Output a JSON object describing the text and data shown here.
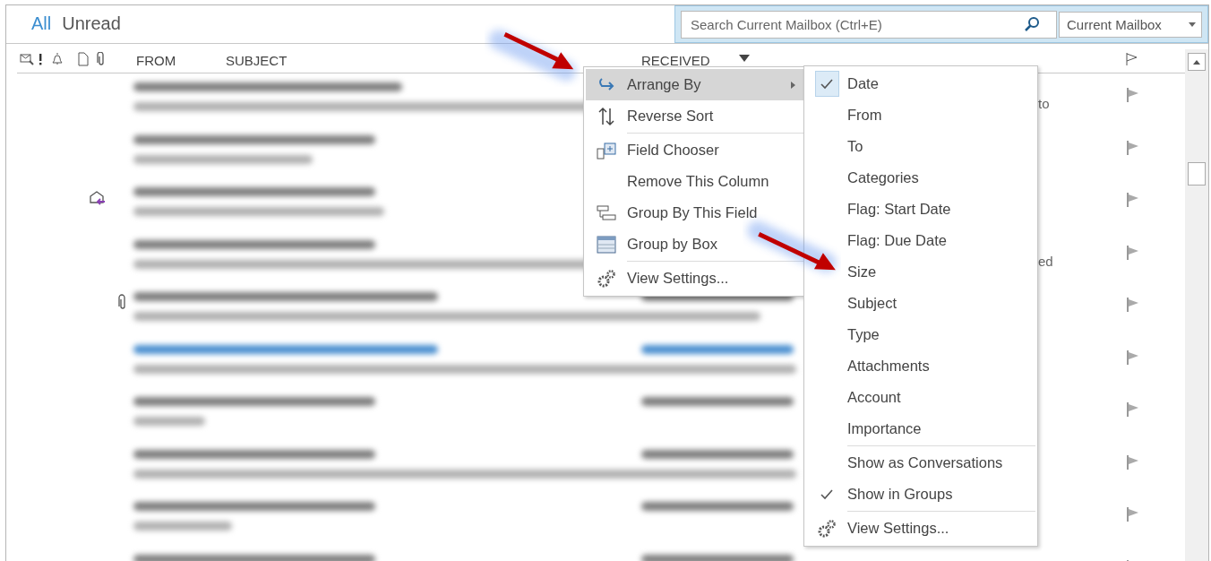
{
  "tabs": [
    {
      "label": "All",
      "selected": true
    },
    {
      "label": "Unread",
      "selected": false
    }
  ],
  "search": {
    "placeholder": "Search Current Mailbox (Ctrl+E)",
    "scope": "Current Mailbox"
  },
  "columns": [
    {
      "kind": "icon"
    },
    {
      "kind": "icon"
    },
    {
      "kind": "icon"
    },
    {
      "kind": "icon"
    },
    {
      "kind": "icon"
    },
    {
      "kind": "text",
      "label": "FROM"
    },
    {
      "kind": "text",
      "label": "SUBJECT"
    },
    {
      "kind": "text",
      "label": "RECEIVED",
      "sorted": true
    },
    {
      "kind": "icon"
    }
  ],
  "messages": [
    {
      "unread": false,
      "replied": false,
      "attachment": false,
      "fragment": "to"
    },
    {
      "unread": false,
      "replied": false,
      "attachment": false
    },
    {
      "unread": false,
      "replied": true,
      "attachment": false
    },
    {
      "unread": false,
      "replied": false,
      "attachment": false,
      "fragment": "ed"
    },
    {
      "unread": false,
      "replied": false,
      "attachment": true
    },
    {
      "unread": true,
      "replied": false,
      "attachment": false
    },
    {
      "unread": false,
      "replied": false,
      "attachment": false
    },
    {
      "unread": false,
      "replied": false,
      "attachment": false
    },
    {
      "unread": false,
      "replied": false,
      "attachment": false
    },
    {
      "unread": false,
      "replied": false,
      "attachment": false
    }
  ],
  "context_menu": {
    "sections": [
      {
        "items": [
          {
            "label": "Arrange By",
            "selected": true,
            "submenu": true
          },
          {
            "label": "Reverse Sort",
            "selected": false,
            "submenu": false
          }
        ]
      },
      {
        "items": [
          {
            "label": "Field Chooser",
            "selected": false,
            "submenu": false
          },
          {
            "label": "Remove This Column",
            "selected": false,
            "submenu": false
          },
          {
            "label": "Group By This Field",
            "selected": false,
            "submenu": false
          },
          {
            "label": "Group by Box",
            "selected": false,
            "submenu": false
          }
        ]
      },
      {
        "items": [
          {
            "label": "View Settings...",
            "selected": false,
            "submenu": false
          }
        ]
      }
    ]
  },
  "arrange_submenu": {
    "sections": [
      {
        "items": [
          {
            "kind": "option",
            "label": "Date",
            "checked": true
          },
          {
            "kind": "option",
            "label": "From",
            "checked": false
          },
          {
            "kind": "option",
            "label": "To",
            "checked": false
          },
          {
            "kind": "option",
            "label": "Categories",
            "checked": false
          },
          {
            "kind": "option",
            "label": "Flag: Start Date",
            "checked": false
          },
          {
            "kind": "option",
            "label": "Flag: Due Date",
            "checked": false
          },
          {
            "kind": "option",
            "label": "Size",
            "checked": false
          },
          {
            "kind": "option",
            "label": "Subject",
            "checked": false
          },
          {
            "kind": "option",
            "label": "Type",
            "checked": false
          },
          {
            "kind": "option",
            "label": "Attachments",
            "checked": false
          },
          {
            "kind": "option",
            "label": "Account",
            "checked": false
          },
          {
            "kind": "option",
            "label": "Importance",
            "checked": false
          }
        ]
      },
      {
        "items": [
          {
            "kind": "toggle",
            "label": "Show as Conversations",
            "checked": false
          },
          {
            "kind": "toggle",
            "label": "Show in Groups",
            "checked": true
          }
        ]
      },
      {
        "items": [
          {
            "kind": "command",
            "label": "View Settings..."
          }
        ]
      }
    ]
  }
}
